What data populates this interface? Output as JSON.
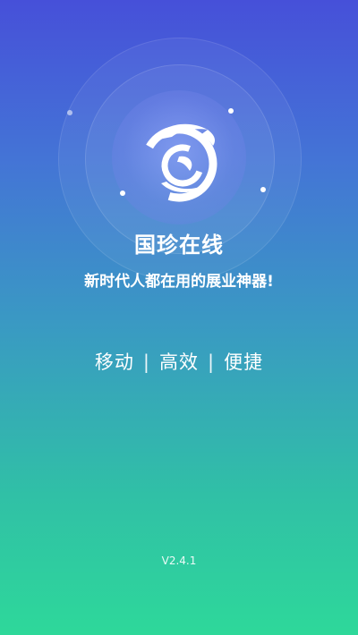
{
  "splash": {
    "app_name": "国珍在线",
    "slogan": "新时代人都在用的展业神器!",
    "features": [
      "移动",
      "高效",
      "便捷"
    ],
    "separator": "|",
    "version": "V2.4.1"
  },
  "colors": {
    "gradient_top": "#4650d9",
    "gradient_bottom": "#2ed89a",
    "text": "#ffffff"
  },
  "icons": {
    "logo": "swirl-logo-icon"
  }
}
